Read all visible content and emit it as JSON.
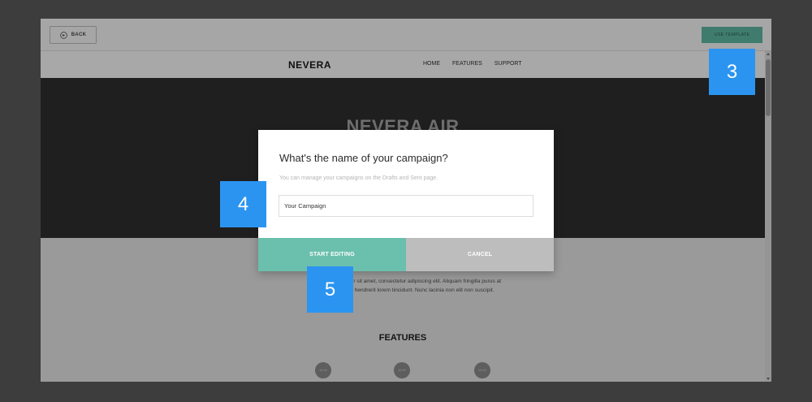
{
  "topbar": {
    "back_label": "BACK",
    "use_template_label": "USE TEMPLATE"
  },
  "site": {
    "logo": "NEVERA",
    "nav": [
      "HOME",
      "FEATURES",
      "SUPPORT"
    ],
    "hero_title": "NEVERA AIR",
    "intro_line1": "Lorem ipsum dolor sit amet, consectetur adipiscing elit. Aliquam fringilla purus at",
    "intro_line2": "ante blandit, ut hendrerit lorem tincidunt. Nunc lacinia non elit non suscipit.",
    "features_title": "FEATURES",
    "feature_icon_label": "40×40"
  },
  "modal": {
    "title": "What's the name of your campaign?",
    "subtitle": "You can manage your campaigns on the Drafts and Sent page.",
    "input_value": "Your Campaign",
    "start_label": "START EDITING",
    "cancel_label": "CANCEL"
  },
  "badges": [
    "3",
    "4",
    "5"
  ],
  "colors": {
    "accent_teal": "#6bbfad",
    "badge_blue": "#2b94f0",
    "cancel_gray": "#bdbdbd"
  }
}
